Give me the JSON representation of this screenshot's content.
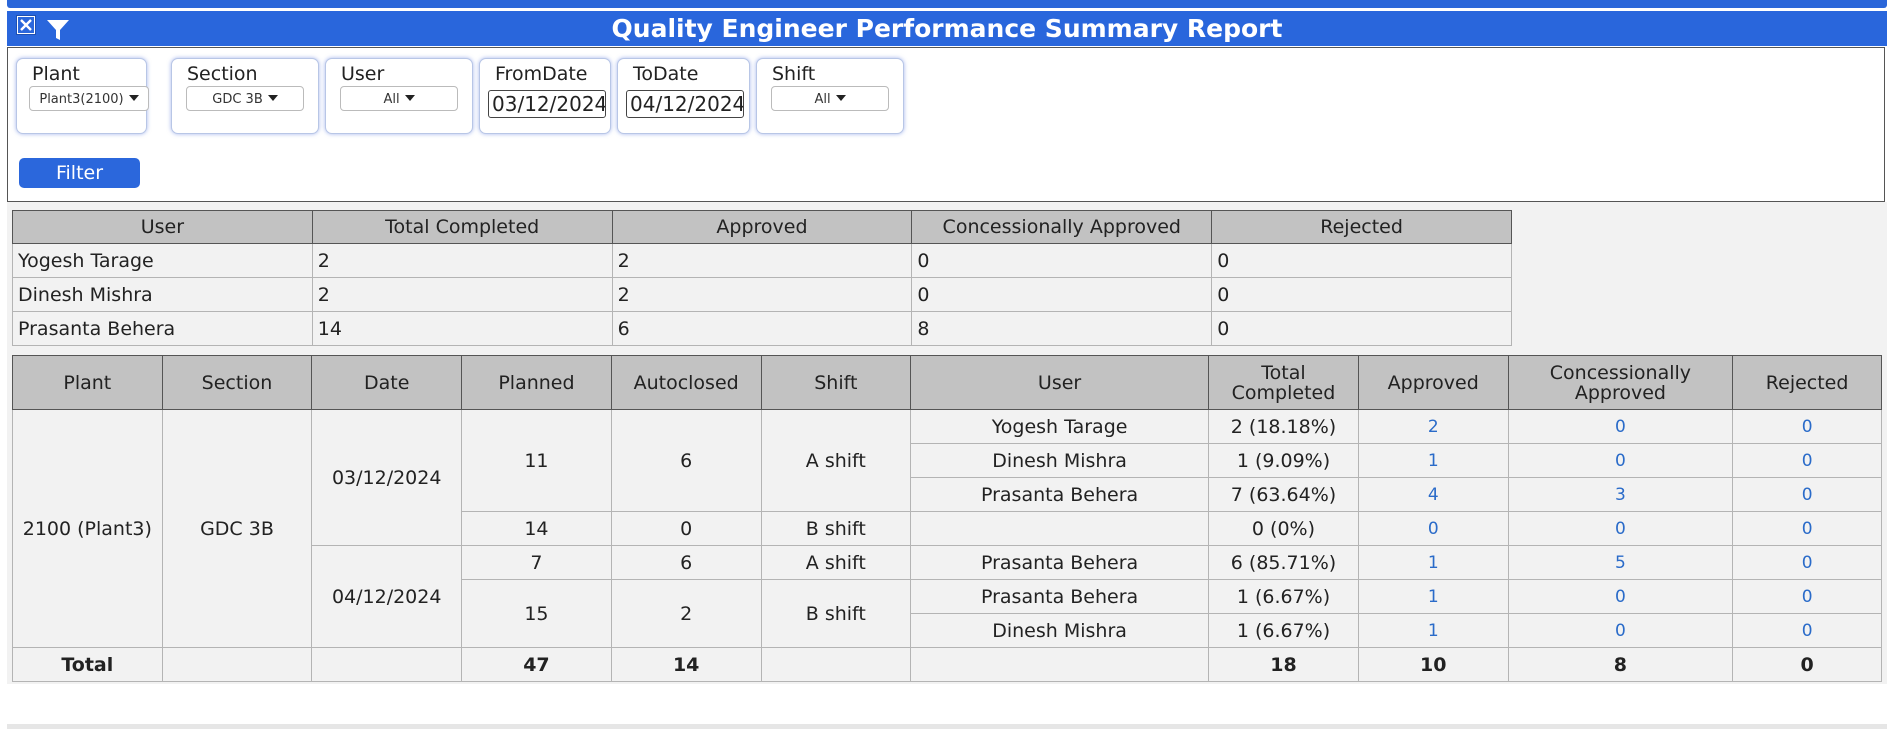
{
  "header": {
    "title": "Quality Engineer Performance Summary Report",
    "colors": {
      "primary": "#2966dc",
      "header_cell": "#c2c2c2",
      "link": "#2a6bc9"
    },
    "icons": [
      "excel-export-icon",
      "filter-icon"
    ]
  },
  "filters": {
    "plant": {
      "label": "Plant",
      "value": "Plant3(2100)"
    },
    "section": {
      "label": "Section",
      "value": "GDC 3B"
    },
    "user": {
      "label": "User",
      "value": "All"
    },
    "from_date": {
      "label": "FromDate",
      "value": "03/12/2024"
    },
    "to_date": {
      "label": "ToDate",
      "value": "04/12/2024"
    },
    "shift": {
      "label": "Shift",
      "value": "All"
    },
    "filter_button": "Filter"
  },
  "summary": {
    "columns": [
      "User",
      "Total Completed",
      "Approved",
      "Concessionally Approved",
      "Rejected"
    ],
    "rows": [
      [
        "Yogesh Tarage",
        "2",
        "2",
        "0",
        "0"
      ],
      [
        "Dinesh Mishra",
        "2",
        "2",
        "0",
        "0"
      ],
      [
        "Prasanta Behera",
        "14",
        "6",
        "8",
        "0"
      ]
    ]
  },
  "detail": {
    "columns": [
      "Plant",
      "Section",
      "Date",
      "Planned",
      "Autoclosed",
      "Shift",
      "User",
      "Total Completed",
      "Approved",
      "Concessionally Approved",
      "Rejected"
    ],
    "plant": "2100 (Plant3)",
    "section": "GDC 3B",
    "dates": [
      "03/12/2024",
      "04/12/2024"
    ],
    "shifts": [
      {
        "planned": "11",
        "autoclosed": "6",
        "shift": "A shift"
      },
      {
        "planned": "14",
        "autoclosed": "0",
        "shift": "B shift"
      },
      {
        "planned": "7",
        "autoclosed": "6",
        "shift": "A shift"
      },
      {
        "planned": "15",
        "autoclosed": "2",
        "shift": "B shift"
      }
    ],
    "rows": [
      {
        "user": "Yogesh Tarage",
        "total": "2 (18.18%)",
        "approved": "2",
        "concession": "0",
        "rejected": "0"
      },
      {
        "user": "Dinesh Mishra",
        "total": "1 (9.09%)",
        "approved": "1",
        "concession": "0",
        "rejected": "0"
      },
      {
        "user": "Prasanta Behera",
        "total": "7 (63.64%)",
        "approved": "4",
        "concession": "3",
        "rejected": "0"
      },
      {
        "user": "",
        "total": "0 (0%)",
        "approved": "0",
        "concession": "0",
        "rejected": "0"
      },
      {
        "user": "Prasanta Behera",
        "total": "6 (85.71%)",
        "approved": "1",
        "concession": "5",
        "rejected": "0"
      },
      {
        "user": "Prasanta Behera",
        "total": "1 (6.67%)",
        "approved": "1",
        "concession": "0",
        "rejected": "0"
      },
      {
        "user": "Dinesh Mishra",
        "total": "1 (6.67%)",
        "approved": "1",
        "concession": "0",
        "rejected": "0"
      }
    ],
    "total": {
      "label": "Total",
      "planned": "47",
      "autoclosed": "14",
      "completed": "18",
      "approved": "10",
      "concession": "8",
      "rejected": "0"
    }
  }
}
